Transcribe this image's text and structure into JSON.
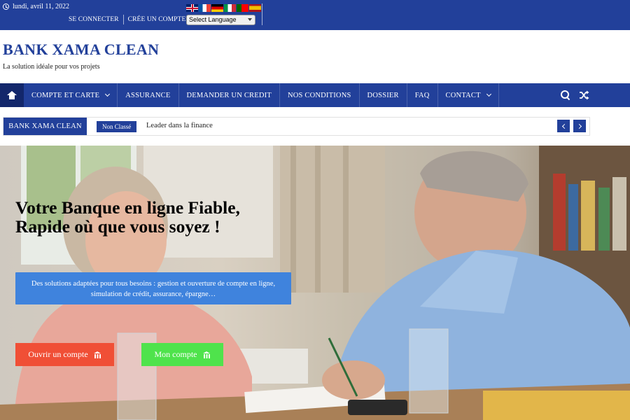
{
  "topbar": {
    "date": "lundi, avril 11, 2022",
    "links": [
      {
        "label": "SE CONNECTER"
      },
      {
        "label": "CRÉE UN COMPTE"
      }
    ],
    "flags": [
      "flag-gb-icon",
      "flag-fr-icon",
      "flag-de-icon",
      "flag-it-icon",
      "flag-pt-icon",
      "flag-es-icon"
    ],
    "language_select": "Select Language"
  },
  "brand": {
    "title": "BANK XAMA CLEAN",
    "tagline": "La solution idéale pour vos projets"
  },
  "nav": {
    "items": [
      {
        "label": "COMPTE ET CARTE",
        "dropdown": true
      },
      {
        "label": "ASSURANCE",
        "dropdown": false
      },
      {
        "label": "DEMANDER UN CREDIT",
        "dropdown": false
      },
      {
        "label": "NOS CONDITIONS",
        "dropdown": false
      },
      {
        "label": "DOSSIER",
        "dropdown": false
      },
      {
        "label": "FAQ",
        "dropdown": false
      },
      {
        "label": "CONTACT",
        "dropdown": true
      }
    ],
    "tools": [
      "search-icon",
      "shuffle-icon"
    ]
  },
  "ticker": {
    "label": "BANK XAMA CLEAN",
    "category": "Non Classé",
    "headline": "Leader dans la finance"
  },
  "hero": {
    "title_line1": "Votre Banque en ligne Fiable,",
    "title_line2": "Rapide où que vous soyez !",
    "description": "Des solutions adaptées pour tous besoins : gestion et ouverture de compte en ligne, simulation de crédit, assurance, épargne…",
    "buttons": [
      {
        "label": "Ouvrir un compte",
        "icon": "bank-icon"
      },
      {
        "label": "Mon compte",
        "icon": "bank-icon"
      }
    ]
  },
  "colors": {
    "primary": "#22409a",
    "nav_home": "#13276b",
    "info_box": "#3f83dd",
    "btn_open": "#f04f36",
    "btn_account": "#4fe34c"
  }
}
